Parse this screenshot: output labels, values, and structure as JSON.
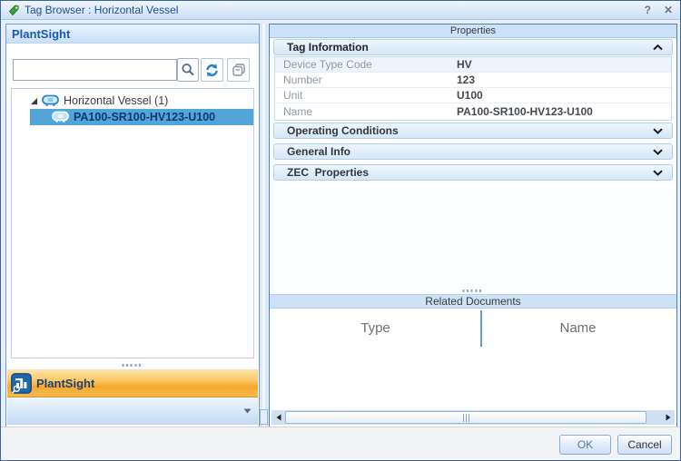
{
  "window": {
    "title": "Tag Browser : Horizontal Vessel",
    "help_label": "?",
    "close_label": "✕"
  },
  "left_panel": {
    "header": "PlantSight",
    "search": {
      "value": "",
      "placeholder": ""
    },
    "tree": {
      "root_label": "Horizontal Vessel (1)",
      "child_label": "PA100-SR100-HV123-U100"
    },
    "bottom_bar_label": "PlantSight"
  },
  "right_panel": {
    "properties_title": "Properties",
    "sections": [
      {
        "label": "Tag Information",
        "expanded": true
      },
      {
        "label": "Operating Conditions",
        "expanded": false
      },
      {
        "label": "General Info",
        "expanded": false
      },
      {
        "label": "ZEC  Properties",
        "expanded": false
      }
    ],
    "tag_information": {
      "rows": [
        {
          "label": "Device Type Code",
          "value": "HV"
        },
        {
          "label": "Number",
          "value": "123"
        },
        {
          "label": "Unit",
          "value": "U100"
        },
        {
          "label": "Name",
          "value": "PA100-SR100-HV123-U100"
        }
      ]
    },
    "related_documents": {
      "title": "Related Documents",
      "columns": [
        "Type",
        "Name"
      ],
      "rows": []
    }
  },
  "footer": {
    "ok_label": "OK",
    "cancel_label": "Cancel"
  },
  "colors": {
    "selection_blue": "#53a5d8",
    "accent_orange": "#f6a82e",
    "panel_border_blue": "#4a7ebc",
    "header_blue": "#cde2f7",
    "title_text_blue": "#1c4e8d",
    "icon_blue": "#1e86c9",
    "tag_icon_green": "#3f9c3a"
  }
}
